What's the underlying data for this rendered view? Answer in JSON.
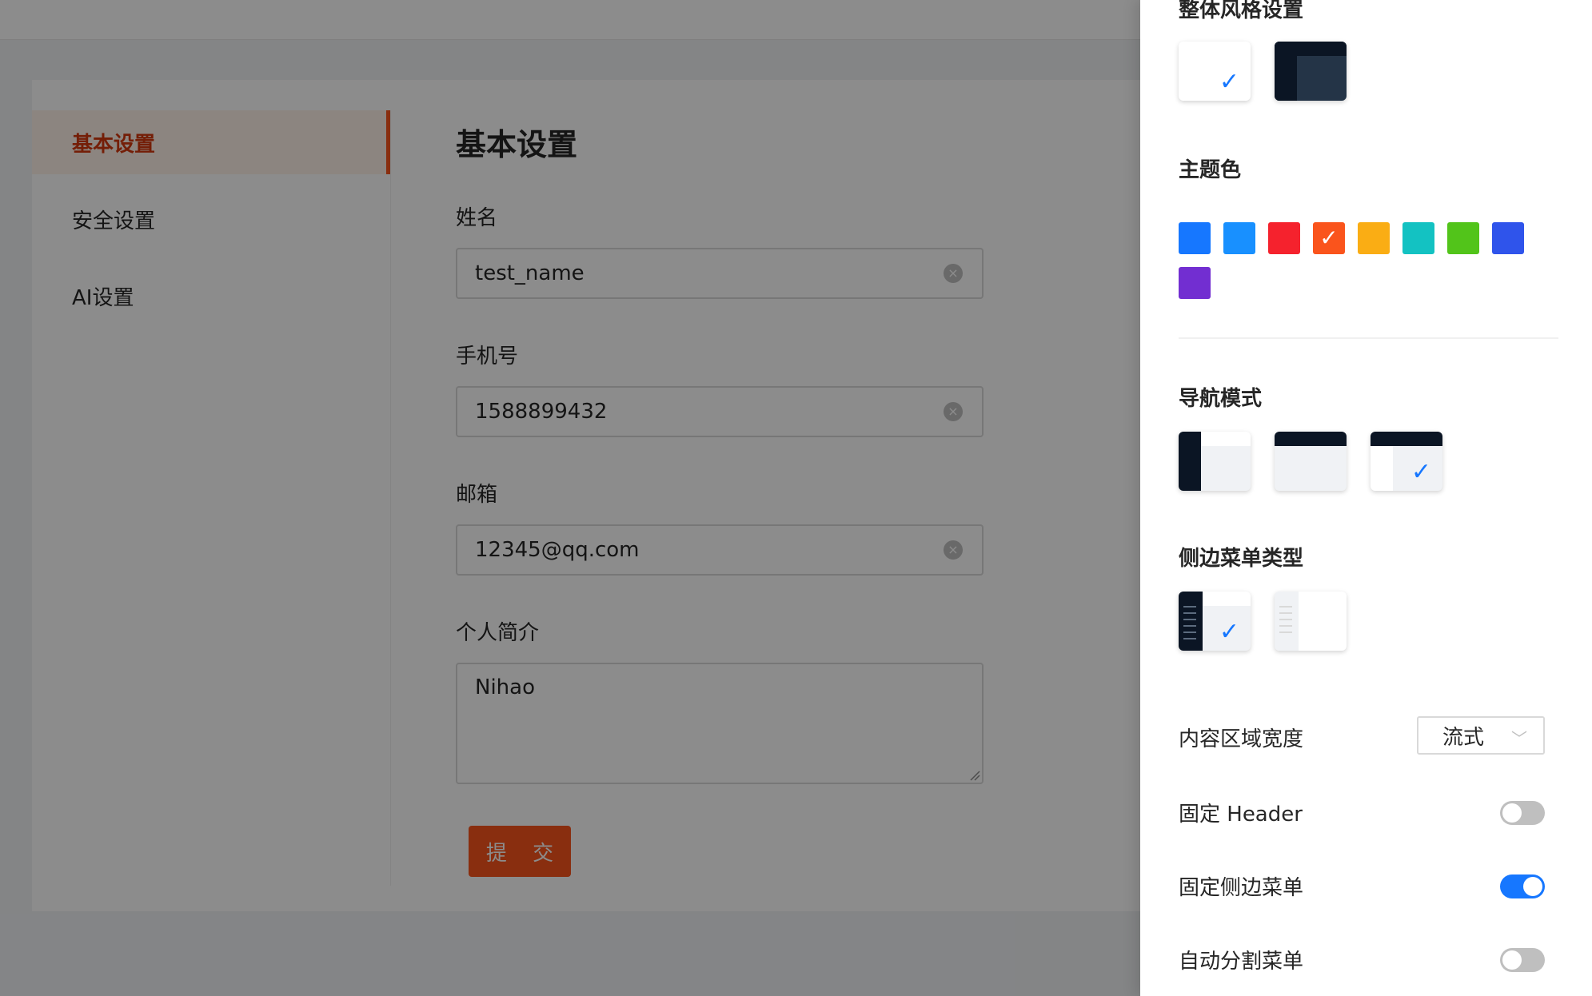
{
  "menu": {
    "items": [
      {
        "label": "基本设置"
      },
      {
        "label": "安全设置"
      },
      {
        "label": "AI设置"
      }
    ]
  },
  "form": {
    "title": "基本设置",
    "name_label": "姓名",
    "name_value": "test_name",
    "phone_label": "手机号",
    "phone_value": "1588899432",
    "email_label": "邮箱",
    "email_value": "12345@qq.com",
    "bio_label": "个人简介",
    "bio_value": "Nihao",
    "submit_label": "提 交"
  },
  "drawer": {
    "style_title": "整体风格设置",
    "style_options": [
      {
        "icon": "light-style-thumbnail",
        "selected": true
      },
      {
        "icon": "dark-style-thumbnail",
        "selected": false
      }
    ],
    "theme_title": "主题色",
    "theme_colors": [
      {
        "color": "#1677ff",
        "selected": false
      },
      {
        "color": "#1890ff",
        "selected": false
      },
      {
        "color": "#f5222d",
        "selected": false
      },
      {
        "color": "#fa541c",
        "selected": true
      },
      {
        "color": "#faad14",
        "selected": false
      },
      {
        "color": "#13c2c2",
        "selected": false
      },
      {
        "color": "#52c41a",
        "selected": false
      },
      {
        "color": "#2f54eb",
        "selected": false
      },
      {
        "color": "#722ed1",
        "selected": false
      }
    ],
    "nav_title": "导航模式",
    "nav_options": [
      {
        "icon": "side-nav-thumbnail",
        "selected": false
      },
      {
        "icon": "top-nav-thumbnail",
        "selected": false
      },
      {
        "icon": "mix-nav-thumbnail",
        "selected": true
      }
    ],
    "sider_title": "侧边菜单类型",
    "sider_options": [
      {
        "icon": "dark-sider-thumbnail",
        "selected": true
      },
      {
        "icon": "light-sider-thumbnail",
        "selected": false
      }
    ],
    "content_width_label": "内容区域宽度",
    "content_width_value": "流式",
    "fixed_header_label": "固定 Header",
    "fixed_header_on": false,
    "fixed_sider_label": "固定侧边菜单",
    "fixed_sider_on": true,
    "split_menu_label": "自动分割菜单",
    "split_menu_on": false
  },
  "colors": {
    "primary": "#fa541c",
    "drawer_accent": "#1677ff"
  }
}
